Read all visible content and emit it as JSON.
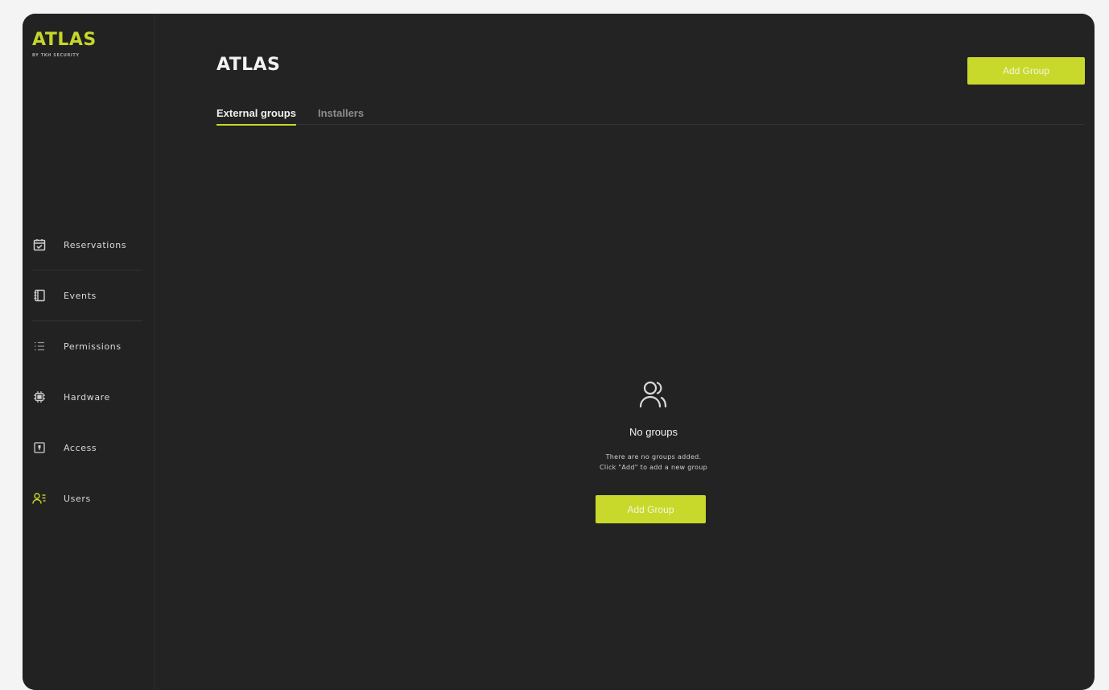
{
  "brand": {
    "name": "ATLAS",
    "subtitle": "BY TKH SECURITY",
    "accent": "#c8d92b"
  },
  "sidebar": {
    "items": [
      {
        "label": "Reservations",
        "icon": "calendar-check-icon"
      },
      {
        "label": "Events",
        "icon": "notebook-icon"
      },
      {
        "label": "Permissions",
        "icon": "list-icon"
      },
      {
        "label": "Hardware",
        "icon": "chip-icon"
      },
      {
        "label": "Access",
        "icon": "door-icon"
      },
      {
        "label": "Users",
        "icon": "users-list-icon"
      }
    ]
  },
  "header": {
    "title": "ATLAS",
    "add_group_label": "Add Group"
  },
  "tabs": [
    {
      "label": "External groups",
      "active": true
    },
    {
      "label": "Installers",
      "active": false
    }
  ],
  "empty_state": {
    "icon": "users-icon",
    "title": "No groups",
    "line1": "There are no groups added.",
    "line2": "Click \"Add\" to add a new group",
    "button_label": "Add Group"
  }
}
